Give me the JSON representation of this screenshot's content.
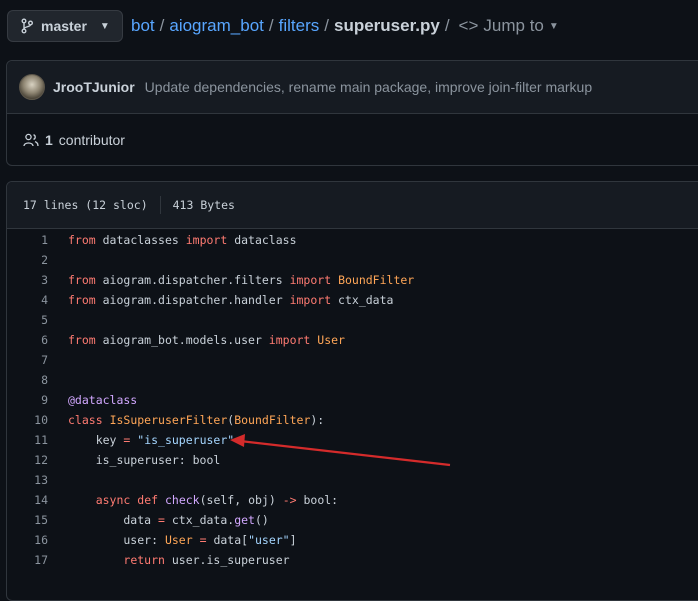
{
  "branch": {
    "name": "master"
  },
  "breadcrumb": {
    "repo": "bot",
    "segments": [
      "aiogram_bot",
      "filters"
    ],
    "file": "superuser.py",
    "jump_label": "Jump to"
  },
  "commit": {
    "author": "JrooTJunior",
    "message": "Update dependencies, rename main package, improve join-filter markup"
  },
  "contributors": {
    "count": "1",
    "label": "contributor"
  },
  "file_info": {
    "lines": "17 lines (12 sloc)",
    "size": "413 Bytes"
  },
  "code_lines": [
    {
      "n": "1",
      "tokens": [
        {
          "t": "from",
          "c": "kw"
        },
        {
          "t": " dataclasses ",
          "c": "tx"
        },
        {
          "t": "import",
          "c": "kw"
        },
        {
          "t": " dataclass",
          "c": "tx"
        }
      ]
    },
    {
      "n": "2",
      "tokens": []
    },
    {
      "n": "3",
      "tokens": [
        {
          "t": "from",
          "c": "kw"
        },
        {
          "t": " aiogram.dispatcher.filters ",
          "c": "tx"
        },
        {
          "t": "import",
          "c": "kw"
        },
        {
          "t": " ",
          "c": "tx"
        },
        {
          "t": "BoundFilter",
          "c": "cls"
        }
      ]
    },
    {
      "n": "4",
      "tokens": [
        {
          "t": "from",
          "c": "kw"
        },
        {
          "t": " aiogram.dispatcher.handler ",
          "c": "tx"
        },
        {
          "t": "import",
          "c": "kw"
        },
        {
          "t": " ctx_data",
          "c": "tx"
        }
      ]
    },
    {
      "n": "5",
      "tokens": []
    },
    {
      "n": "6",
      "tokens": [
        {
          "t": "from",
          "c": "kw"
        },
        {
          "t": " aiogram_bot.models.user ",
          "c": "tx"
        },
        {
          "t": "import",
          "c": "kw"
        },
        {
          "t": " ",
          "c": "tx"
        },
        {
          "t": "User",
          "c": "cls"
        }
      ]
    },
    {
      "n": "7",
      "tokens": []
    },
    {
      "n": "8",
      "tokens": []
    },
    {
      "n": "9",
      "tokens": [
        {
          "t": "@dataclass",
          "c": "fn"
        }
      ]
    },
    {
      "n": "10",
      "tokens": [
        {
          "t": "class",
          "c": "kw"
        },
        {
          "t": " ",
          "c": "tx"
        },
        {
          "t": "IsSuperuserFilter",
          "c": "cls"
        },
        {
          "t": "(",
          "c": "tx"
        },
        {
          "t": "BoundFilter",
          "c": "cls"
        },
        {
          "t": "):",
          "c": "tx"
        }
      ]
    },
    {
      "n": "11",
      "tokens": [
        {
          "t": "    key ",
          "c": "tx"
        },
        {
          "t": "=",
          "c": "op"
        },
        {
          "t": " ",
          "c": "tx"
        },
        {
          "t": "\"is_superuser\"",
          "c": "str"
        }
      ]
    },
    {
      "n": "12",
      "tokens": [
        {
          "t": "    is_superuser: bool",
          "c": "tx"
        }
      ]
    },
    {
      "n": "13",
      "tokens": []
    },
    {
      "n": "14",
      "tokens": [
        {
          "t": "    ",
          "c": "tx"
        },
        {
          "t": "async",
          "c": "kw"
        },
        {
          "t": " ",
          "c": "tx"
        },
        {
          "t": "def",
          "c": "kw"
        },
        {
          "t": " ",
          "c": "tx"
        },
        {
          "t": "check",
          "c": "fn"
        },
        {
          "t": "(self, obj) ",
          "c": "tx"
        },
        {
          "t": "->",
          "c": "op"
        },
        {
          "t": " bool:",
          "c": "tx"
        }
      ]
    },
    {
      "n": "15",
      "tokens": [
        {
          "t": "        data ",
          "c": "tx"
        },
        {
          "t": "=",
          "c": "op"
        },
        {
          "t": " ctx_data.",
          "c": "tx"
        },
        {
          "t": "get",
          "c": "fn"
        },
        {
          "t": "()",
          "c": "tx"
        }
      ]
    },
    {
      "n": "16",
      "tokens": [
        {
          "t": "        user: ",
          "c": "tx"
        },
        {
          "t": "User",
          "c": "cls"
        },
        {
          "t": " ",
          "c": "tx"
        },
        {
          "t": "=",
          "c": "op"
        },
        {
          "t": " data[",
          "c": "tx"
        },
        {
          "t": "\"user\"",
          "c": "str"
        },
        {
          "t": "]",
          "c": "tx"
        }
      ]
    },
    {
      "n": "17",
      "tokens": [
        {
          "t": "        ",
          "c": "tx"
        },
        {
          "t": "return",
          "c": "kw"
        },
        {
          "t": " user.is_superuser",
          "c": "tx"
        }
      ]
    }
  ],
  "annotation": {
    "color": "#d42b2b",
    "target_line": "11"
  }
}
